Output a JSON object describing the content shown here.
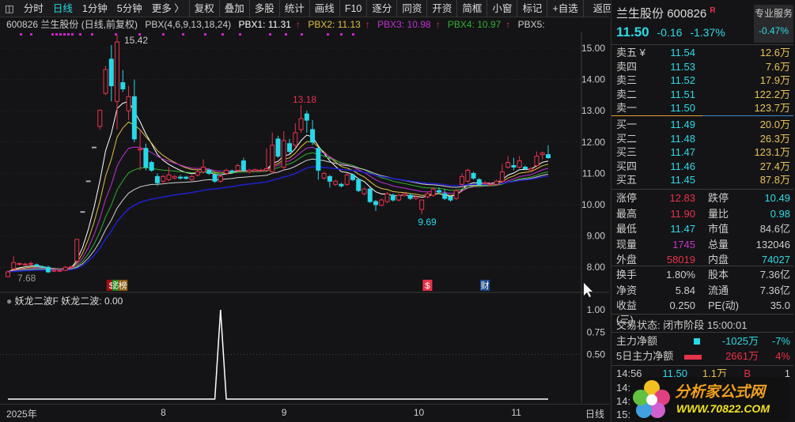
{
  "toolbar": {
    "period_tabs": [
      "分时",
      "日线",
      "1分钟",
      "5分钟",
      "更多 〉"
    ],
    "active_tab": "日线",
    "buttons": [
      "复权",
      "叠加",
      "多股",
      "统计",
      "画线",
      "F10",
      "逐分",
      "同资",
      "开资",
      "简框",
      "小窗",
      "标记",
      "+自选",
      "返回"
    ]
  },
  "infobar": {
    "title": "600826 兰生股份 (日线,前复权)",
    "indicator": "PBX(4,6,9,13,18,24)",
    "pbx1": "PBX1: 11.31",
    "pbx2": "PBX2: 11.13",
    "pbx3": "PBX3: 10.98",
    "pbx4": "PBX4: 10.97",
    "pbx5": "PBX5: ",
    "arrow": "↑"
  },
  "colors": {
    "up": "#e8324a",
    "down": "#27d8e8",
    "pbx1": "#ffffff",
    "pbx2": "#e0c040",
    "pbx3": "#c030d0",
    "pbx4": "#30b030",
    "pbx5": "#d0d0d0",
    "pbx6": "#2020d0"
  },
  "chart_data": {
    "type": "candlestick",
    "price_ticks": [
      "15.00",
      "14.00",
      "13.00",
      "12.00",
      "11.00",
      "10.00",
      "9.00",
      "8.00"
    ],
    "ylim": [
      7.5,
      15.5
    ],
    "high_label": "15.42",
    "low_label": "9.69",
    "peak2_label": "13.18",
    "start_low_label": "7.68",
    "candles": [
      [
        7.7,
        7.9,
        7.68,
        7.85
      ],
      [
        7.95,
        8.35,
        7.9,
        8.15
      ],
      [
        8.1,
        8.15,
        8.05,
        8.12
      ],
      [
        8.1,
        8.15,
        8.05,
        8.1
      ],
      [
        8.1,
        8.18,
        8.05,
        8.12
      ],
      [
        8.08,
        8.12,
        8.0,
        8.03
      ],
      [
        8.02,
        8.05,
        7.98,
        8.0
      ],
      [
        8.0,
        8.05,
        7.82,
        7.85
      ],
      [
        7.9,
        7.95,
        7.85,
        7.9
      ],
      [
        7.9,
        7.95,
        7.85,
        7.9
      ],
      [
        7.9,
        8.05,
        7.88,
        8.0
      ],
      [
        8.0,
        8.05,
        7.95,
        8.02
      ],
      [
        8.2,
        8.9,
        8.15,
        8.89
      ],
      [
        9.78,
        9.78,
        9.78,
        9.78
      ],
      [
        10.76,
        10.76,
        10.76,
        10.76
      ],
      [
        11.84,
        11.84,
        11.84,
        11.84
      ],
      [
        12.5,
        13.02,
        12.4,
        13.02
      ],
      [
        13.56,
        14.44,
        13.5,
        14.32
      ],
      [
        14.65,
        15.1,
        13.3,
        13.8
      ],
      [
        13.3,
        15.42,
        12.4,
        15.2
      ],
      [
        13.9,
        14.3,
        13.6,
        13.7
      ],
      [
        13.0,
        13.8,
        12.7,
        13.45
      ],
      [
        13.45,
        14.0,
        12.0,
        12.1
      ],
      [
        11.75,
        12.4,
        11.1,
        11.78
      ],
      [
        11.8,
        11.95,
        11.1,
        11.2
      ],
      [
        11.35,
        11.4,
        11.05,
        11.1
      ],
      [
        10.9,
        11.0,
        10.6,
        10.7
      ],
      [
        10.75,
        10.95,
        10.65,
        10.9
      ],
      [
        10.8,
        11.2,
        10.75,
        10.95
      ],
      [
        10.85,
        10.95,
        10.8,
        10.9
      ],
      [
        10.88,
        10.95,
        10.8,
        10.85
      ],
      [
        10.88,
        10.92,
        10.8,
        10.84
      ],
      [
        10.8,
        10.95,
        10.75,
        10.9
      ],
      [
        10.95,
        11.1,
        10.9,
        11.05
      ],
      [
        11.05,
        11.45,
        11.0,
        11.2
      ],
      [
        11.1,
        11.15,
        10.95,
        11.0
      ],
      [
        10.95,
        11.0,
        10.7,
        10.75
      ],
      [
        10.75,
        10.95,
        10.7,
        10.9
      ],
      [
        11.0,
        11.15,
        10.95,
        11.1
      ],
      [
        11.08,
        11.12,
        11.0,
        11.04
      ],
      [
        11.1,
        11.3,
        11.05,
        11.25
      ],
      [
        11.4,
        11.5,
        11.05,
        11.1
      ],
      [
        11.05,
        11.15,
        11.0,
        11.1
      ],
      [
        11.08,
        11.15,
        11.05,
        11.12
      ],
      [
        11.1,
        11.15,
        11.05,
        11.1
      ],
      [
        11.1,
        11.8,
        11.05,
        11.15
      ],
      [
        11.05,
        12.3,
        11.0,
        11.9
      ],
      [
        12.1,
        12.2,
        11.5,
        11.55
      ],
      [
        11.2,
        12.35,
        11.1,
        12.05
      ],
      [
        11.95,
        12.1,
        11.6,
        11.7
      ],
      [
        11.9,
        12.6,
        11.8,
        12.3
      ],
      [
        12.4,
        13.18,
        12.3,
        12.75
      ],
      [
        12.9,
        13.0,
        12.3,
        12.7
      ],
      [
        12.4,
        12.7,
        11.9,
        12.0
      ],
      [
        11.8,
        11.85,
        10.8,
        11.1
      ],
      [
        10.85,
        11.05,
        10.8,
        11.0
      ],
      [
        10.9,
        10.95,
        10.55,
        10.75
      ],
      [
        10.65,
        10.8,
        10.6,
        10.75
      ],
      [
        10.65,
        10.7,
        10.55,
        10.6
      ],
      [
        10.65,
        11.0,
        10.6,
        10.95
      ],
      [
        10.95,
        11.0,
        10.75,
        10.8
      ],
      [
        10.8,
        10.85,
        10.4,
        10.45
      ],
      [
        10.35,
        10.55,
        10.3,
        10.5
      ],
      [
        10.5,
        10.55,
        10.05,
        10.1
      ],
      [
        10.1,
        10.15,
        9.8,
        10.0
      ],
      [
        9.98,
        10.2,
        9.95,
        10.15
      ],
      [
        10.1,
        10.4,
        10.05,
        10.35
      ],
      [
        10.3,
        10.35,
        10.1,
        10.15
      ],
      [
        10.15,
        10.35,
        10.1,
        10.3
      ],
      [
        10.3,
        10.4,
        10.25,
        10.35
      ],
      [
        10.3,
        10.35,
        10.15,
        10.2
      ],
      [
        10.2,
        10.3,
        10.15,
        10.25
      ],
      [
        9.85,
        10.15,
        9.69,
        10.15
      ],
      [
        10.25,
        10.4,
        10.2,
        10.35
      ],
      [
        10.3,
        10.55,
        10.25,
        10.5
      ],
      [
        10.45,
        10.55,
        10.35,
        10.4
      ],
      [
        10.35,
        10.5,
        10.15,
        10.2
      ],
      [
        10.25,
        10.3,
        10.1,
        10.15
      ],
      [
        10.2,
        10.5,
        10.15,
        10.45
      ],
      [
        10.65,
        11.0,
        10.6,
        10.9
      ],
      [
        10.75,
        11.15,
        10.7,
        11.1
      ],
      [
        11.0,
        11.05,
        10.8,
        10.85
      ],
      [
        10.8,
        10.85,
        10.6,
        10.65
      ],
      [
        10.7,
        10.75,
        10.65,
        10.7
      ],
      [
        10.65,
        10.7,
        10.6,
        10.66
      ],
      [
        10.65,
        10.8,
        10.6,
        10.75
      ],
      [
        10.75,
        11.3,
        10.7,
        11.05
      ],
      [
        11.2,
        11.55,
        11.15,
        11.35
      ],
      [
        11.25,
        11.5,
        11.1,
        11.2
      ],
      [
        11.2,
        11.55,
        11.15,
        11.4
      ],
      [
        11.2,
        11.25,
        11.1,
        11.15
      ],
      [
        11.1,
        11.2,
        11.05,
        11.15
      ],
      [
        11.25,
        11.7,
        11.2,
        11.55
      ],
      [
        11.6,
        11.7,
        11.45,
        11.65
      ],
      [
        11.6,
        11.9,
        11.47,
        11.5
      ]
    ],
    "signal_index": 37,
    "markers": [
      {
        "label": "$",
        "idx": 18,
        "color": "#a01010"
      },
      {
        "label": "跌",
        "idx": 19,
        "color": "#1a8a1a"
      },
      {
        "label": "榜",
        "idx": 20,
        "color": "#8a5a10"
      },
      {
        "label": "$",
        "idx": 73,
        "color": "#e8324a"
      },
      {
        "label": "财",
        "idx": 83,
        "color": "#1a4a8a"
      }
    ],
    "lower": {
      "title": "妖龙二波F",
      "value_label": "妖龙二波: 0.00",
      "ticks": [
        "1.00",
        "0.75",
        "0.50"
      ]
    },
    "x_ticks": [
      {
        "label": "2025年",
        "idx": 0
      },
      {
        "label": "8",
        "idx": 27
      },
      {
        "label": "9",
        "idx": 48
      },
      {
        "label": "10",
        "idx": 71
      },
      {
        "label": "11",
        "idx": 88
      }
    ],
    "period_label": "日线"
  },
  "quote": {
    "name": "兰生股份",
    "code": "600826",
    "badge": "R",
    "service": "专业服务",
    "price": "11.50",
    "change": "-0.16",
    "pct": "-1.37%",
    "service_pct": "-0.47%",
    "asks": [
      {
        "l": "卖五 ¥",
        "p": "11.54",
        "v": "12.6万"
      },
      {
        "l": "卖四",
        "p": "11.53",
        "v": "7.6万"
      },
      {
        "l": "卖三",
        "p": "11.52",
        "v": "17.9万"
      },
      {
        "l": "卖二",
        "p": "11.51",
        "v": "122.2万"
      },
      {
        "l": "卖一",
        "p": "11.50",
        "v": "123.7万"
      }
    ],
    "bids": [
      {
        "l": "买一",
        "p": "11.49",
        "v": "20.0万"
      },
      {
        "l": "买二",
        "p": "11.48",
        "v": "26.3万"
      },
      {
        "l": "买三",
        "p": "11.47",
        "v": "123.1万"
      },
      {
        "l": "买四",
        "p": "11.46",
        "v": "27.4万"
      },
      {
        "l": "买五",
        "p": "11.45",
        "v": "87.8万"
      }
    ],
    "stats": [
      [
        "涨停",
        "12.83",
        "跌停",
        "10.49"
      ],
      [
        "最高",
        "11.90",
        "量比",
        "0.98"
      ],
      [
        "最低",
        "11.47",
        "市值",
        "84.6亿"
      ],
      [
        "现量",
        "1745",
        "总量",
        "132046"
      ],
      [
        "外盘",
        "58019",
        "内盘",
        "74027"
      ]
    ],
    "stats2": [
      [
        "换手",
        "1.80%",
        "股本",
        "7.36亿"
      ],
      [
        "净资",
        "5.84",
        "流通",
        "7.36亿"
      ],
      [
        "收益(三)",
        "0.250",
        "PE(动)",
        "35.0"
      ]
    ],
    "trade_status": "交易状态: 闭市阶段 15:00:01",
    "flow": [
      {
        "l": "主力净额",
        "v": "-1025万",
        "p": "-7%"
      },
      {
        "l": "5日主力净额",
        "v": "2661万",
        "p": "4%"
      }
    ],
    "tick": {
      "time": "14:56",
      "price": "11.50",
      "vol": "1.1万",
      "bs": "B",
      "n": "1"
    },
    "tick_times": [
      "14:",
      "14:",
      "15:"
    ],
    "logo": {
      "text": "分析家公式网",
      "url": "WWW.70822.COM"
    }
  }
}
